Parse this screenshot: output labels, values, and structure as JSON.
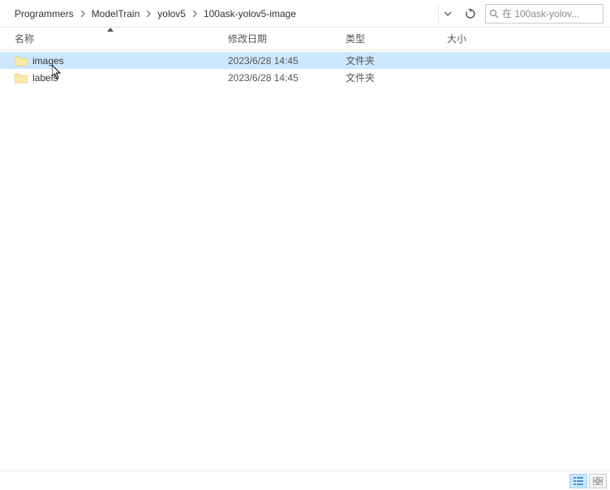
{
  "breadcrumb": {
    "items": [
      "Programmers",
      "ModelTrain",
      "yolov5",
      "100ask-yolov5-image"
    ]
  },
  "search": {
    "placeholder": "在 100ask-yolov..."
  },
  "columns": {
    "name": "名称",
    "modified": "修改日期",
    "type": "类型",
    "size": "大小"
  },
  "files": [
    {
      "name": "images",
      "modified": "2023/6/28 14:45",
      "type": "文件夹",
      "size": "",
      "hovered": true
    },
    {
      "name": "labels",
      "modified": "2023/6/28 14:45",
      "type": "文件夹",
      "size": "",
      "hovered": false
    }
  ]
}
